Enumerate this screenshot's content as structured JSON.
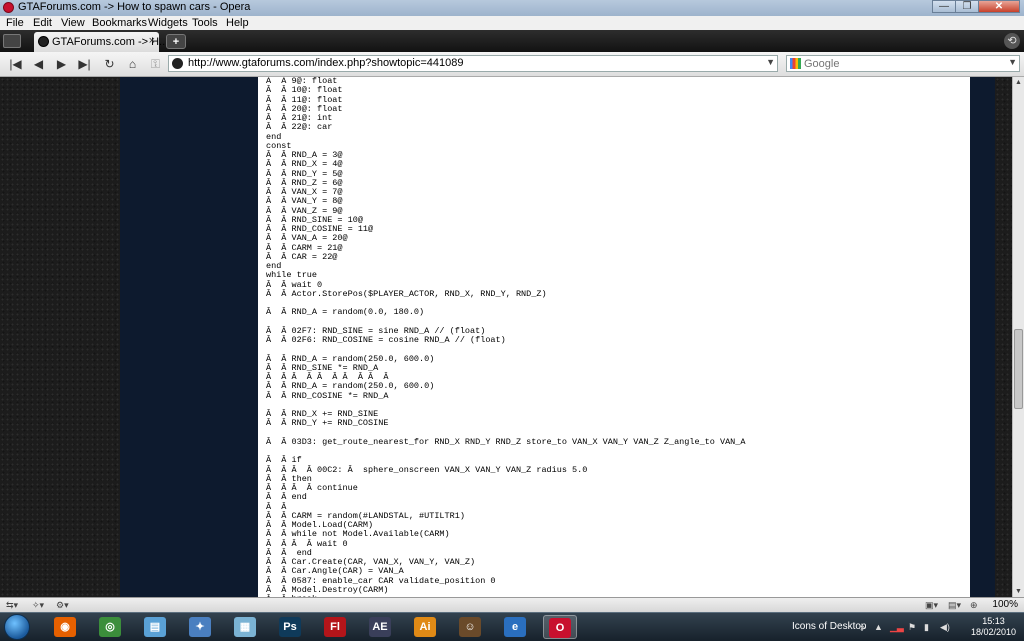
{
  "window": {
    "title": "GTAForums.com -> How to spawn cars - Opera",
    "controls": [
      "—",
      "❐",
      "✕"
    ]
  },
  "menu": [
    "File",
    "Edit",
    "View",
    "Bookmarks",
    "Widgets",
    "Tools",
    "Help"
  ],
  "tabs": [
    {
      "label": "GTAForums.com -> H...",
      "close": "×"
    }
  ],
  "new_tab": "+",
  "toolbar": {
    "back": "|◀",
    "rewind": "◀",
    "forward": "▶",
    "fast_forward": "▶|",
    "reload": "↻",
    "home": "⌂",
    "url": "http://www.gtaforums.com/index.php?showtopic=441089",
    "search_placeholder": "Google"
  },
  "code_lines": [
    "Â  Â 9@: float",
    "Â  Â 10@: float",
    "Â  Â 11@: float",
    "Â  Â 20@: float",
    "Â  Â 21@: int",
    "Â  Â 22@: car",
    "end",
    "const",
    "Â  Â RND_A = 3@",
    "Â  Â RND_X = 4@",
    "Â  Â RND_Y = 5@",
    "Â  Â RND_Z = 6@",
    "Â  Â VAN_X = 7@",
    "Â  Â VAN_Y = 8@",
    "Â  Â VAN_Z = 9@",
    "Â  Â RND_SINE = 10@",
    "Â  Â RND_COSINE = 11@",
    "Â  Â VAN_A = 20@",
    "Â  Â CARM = 21@",
    "Â  Â CAR = 22@",
    "end",
    "while true",
    "Â  Â wait 0",
    "Â  Â Actor.StorePos($PLAYER_ACTOR, RND_X, RND_Y, RND_Z)",
    "",
    "Â  Â RND_A = random(0.0, 180.0)",
    "",
    "Â  Â 02F7: RND_SINE = sine RND_A // (float)",
    "Â  Â 02F6: RND_COSINE = cosine RND_A // (float)",
    "",
    "Â  Â RND_A = random(250.0, 600.0)",
    "Â  Â RND_SINE *= RND_A",
    "Â  Â Â  Â Â  Â Â  Â Â  Â",
    "Â  Â RND_A = random(250.0, 600.0)",
    "Â  Â RND_COSINE *= RND_A",
    "",
    "Â  Â RND_X += RND_SINE",
    "Â  Â RND_Y += RND_COSINE",
    "",
    "Â  Â 03D3: get_route_nearest_for RND_X RND_Y RND_Z store_to VAN_X VAN_Y VAN_Z Z_angle_to VAN_A",
    "",
    "Â  Â if",
    "Â  Â Â  Â 00C2: Â  sphere_onscreen VAN_X VAN_Y VAN_Z radius 5.0",
    "Â  Â then",
    "Â  Â Â  Â continue",
    "Â  Â end",
    "Â  Â",
    "Â  Â CARM = random(#LANDSTAL, #UTILTR1)",
    "Â  Â Model.Load(CARM)",
    "Â  Â while not Model.Available(CARM)",
    "Â  Â Â  Â wait 0",
    "Â  Â  end",
    "Â  Â Car.Create(CAR, VAN_X, VAN_Y, VAN_Z)",
    "Â  Â Car.Angle(CAR) = VAN_A",
    "Â  Â 0587: enable_car CAR validate_position 0",
    "Â  Â Model.Destroy(CARM)",
    "Â  Â break"
  ],
  "status": {
    "zoom": "100%"
  },
  "taskbar": {
    "apps": [
      {
        "name": "firefox",
        "label": "◉",
        "color": "#e66000"
      },
      {
        "name": "chrome",
        "label": "◎",
        "color": "#3b8e3b"
      },
      {
        "name": "notepad",
        "label": "▤",
        "color": "#5aa1d6"
      },
      {
        "name": "gamepad",
        "label": "✦",
        "color": "#4a7fc0"
      },
      {
        "name": "explorer",
        "label": "▦",
        "color": "#7bb3d4"
      },
      {
        "name": "photoshop",
        "label": "Ps",
        "color": "#0f3a5a"
      },
      {
        "name": "flash",
        "label": "Fl",
        "color": "#b4151a"
      },
      {
        "name": "aftereffects",
        "label": "AE",
        "color": "#3a3f5a"
      },
      {
        "name": "illustrator",
        "label": "Ai",
        "color": "#e08a16"
      },
      {
        "name": "game",
        "label": "☺",
        "color": "#6a4a2a"
      },
      {
        "name": "ie",
        "label": "e",
        "color": "#2a6fbf"
      },
      {
        "name": "opera",
        "label": "O",
        "color": "#c8102e"
      }
    ],
    "tray_label": "Icons of Desktop",
    "time": "15:13",
    "date": "18/02/2010"
  }
}
